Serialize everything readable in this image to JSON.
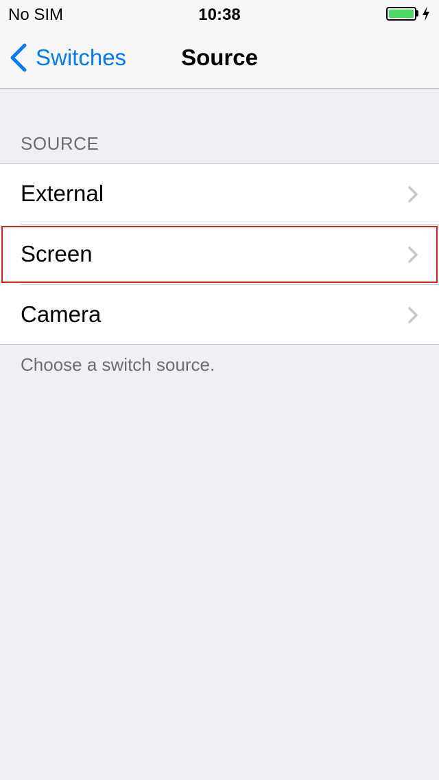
{
  "status_bar": {
    "carrier": "No SIM",
    "time": "10:38",
    "battery_icon": "battery-charging-icon",
    "battery_color": "#4cd964"
  },
  "nav": {
    "back_label": "Switches",
    "back_icon": "chevron-left-icon",
    "title": "Source",
    "accent_color": "#007aff"
  },
  "section": {
    "header": "SOURCE",
    "footer": "Choose a switch source.",
    "rows": [
      {
        "label": "External",
        "icon": "chevron-right-icon"
      },
      {
        "label": "Screen",
        "icon": "chevron-right-icon",
        "highlighted": true
      },
      {
        "label": "Camera",
        "icon": "chevron-right-icon"
      }
    ]
  }
}
